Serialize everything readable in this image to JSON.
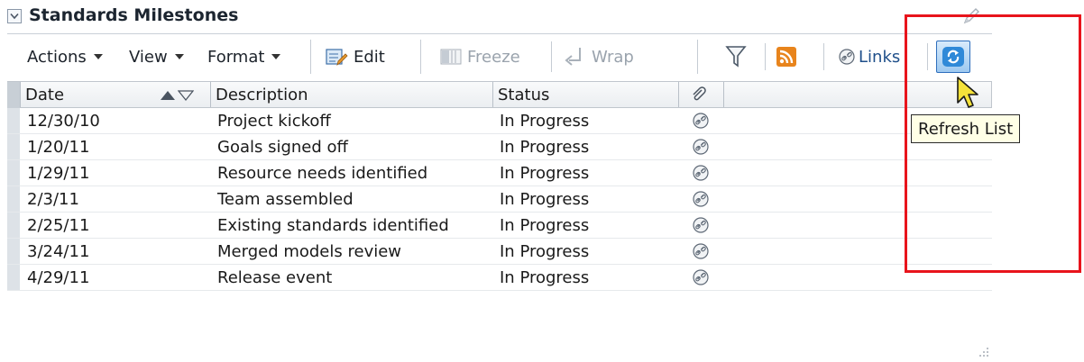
{
  "panel": {
    "title": "Standards Milestones"
  },
  "toolbar": {
    "actions_label": "Actions",
    "view_label": "View",
    "format_label": "Format",
    "edit_label": "Edit",
    "freeze_label": "Freeze",
    "wrap_label": "Wrap",
    "links_label": "Links"
  },
  "table": {
    "columns": [
      "Date",
      "Description",
      "Status"
    ],
    "rows": [
      {
        "date": "12/30/10",
        "description": "Project kickoff",
        "status": "In Progress"
      },
      {
        "date": "1/20/11",
        "description": "Goals signed off",
        "status": "In Progress"
      },
      {
        "date": "1/29/11",
        "description": "Resource needs identified",
        "status": "In Progress"
      },
      {
        "date": "2/3/11",
        "description": "Team assembled",
        "status": "In Progress"
      },
      {
        "date": "2/25/11",
        "description": "Existing standards identified",
        "status": "In Progress"
      },
      {
        "date": "3/24/11",
        "description": "Merged models review",
        "status": "In Progress"
      },
      {
        "date": "4/29/11",
        "description": "Release event",
        "status": "In Progress"
      }
    ]
  },
  "tooltip": {
    "text": "Refresh List"
  },
  "colors": {
    "highlight_box": "#e8141c",
    "refresh_button": "#2f89d8",
    "rss_icon": "#e8841c",
    "tooltip_bg": "#ffffe6"
  }
}
